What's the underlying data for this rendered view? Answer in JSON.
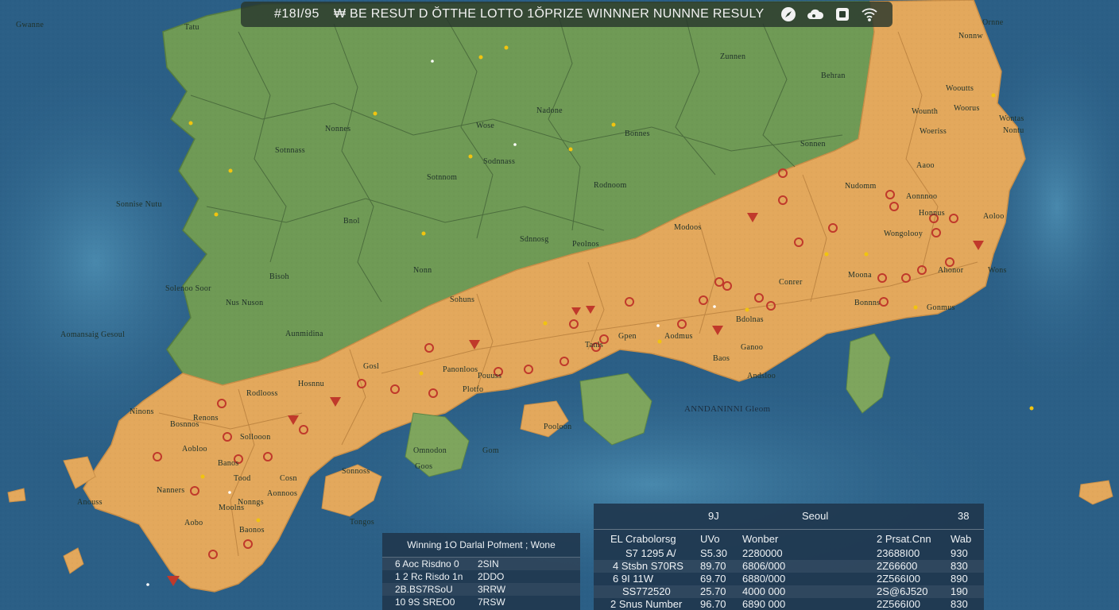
{
  "header": {
    "draw_number": "#18I/95",
    "title": "₩ BE RESUT D ŎTTHE LOTTO 1ŎPRIZE WINNNER NUNNNE RESULY",
    "icons": [
      "compass-icon",
      "cloud-icon",
      "camera-icon",
      "wifi-icon"
    ]
  },
  "colors": {
    "sea": "#2b5f86",
    "sea_shallow": "#3e7ea3",
    "land_green": "#6f9a55",
    "land_orange": "#e3a85c",
    "marker_red": "#c0392b",
    "marker_yellow": "#f1c40f",
    "panel_bg": "#203750"
  },
  "map": {
    "labels": [
      "Gwanne",
      "Tatu",
      "Ornne",
      "Zunnen",
      "Behran",
      "Nonnw",
      "Nadone",
      "Wooutts",
      "Wounth",
      "Woorus",
      "Wontas",
      "Woeriss",
      "Nonnes",
      "Wose",
      "Bonnes",
      "Nontu",
      "Sonnise Nutu",
      "Sotnnass",
      "Bnol",
      "Sodnnass",
      "Sonnen",
      "Sotnnom",
      "Rodnoom",
      "Solenoo Soor",
      "Nus Nuson",
      "Aomansaig Gesoul",
      "Aunmidina",
      "Sdnnosg",
      "Bisoh",
      "Nonn",
      "Sohuns",
      "Aaoo",
      "Nudomm",
      "Aonnnoo",
      "Honnus",
      "Aoloo",
      "Wongolooy",
      "Ahonor",
      "Moona",
      "Wons",
      "Conrer",
      "Bdolnas",
      "Panonloos",
      "Pouuss",
      "Anmoonnian Cleom",
      "Ganoo",
      "Baos",
      "Andsloo",
      "Bonnns",
      "Gonmus",
      "Aodmus",
      "Gpen",
      "Tanls",
      "Plotfo",
      "Gosl",
      "Hosnnu",
      "Rodlooss",
      "Ninons",
      "Renons",
      "Bosnnos",
      "Sollooon",
      "Aobloo",
      "Banos",
      "Cosn",
      "Tood",
      "Nanners",
      "Aonnoos",
      "Nonngs",
      "Anouss",
      "Moolns",
      "Aobo",
      "Baonos",
      "Sonnoss",
      "Omnodon",
      "Gom",
      "Pooloon",
      "Goos",
      "Tongos",
      "Peolnos",
      "Modoos"
    ],
    "sea_label": "ANNDANINNI Gleom"
  },
  "left_panel": {
    "title": "Winning 1O Darlal Pofment ; Wone",
    "rows": [
      {
        "a": "6 Aoc Risdno 0",
        "b": "2SIN"
      },
      {
        "a": "1 2 Rc Risdo 1n",
        "b": "2DDO"
      },
      {
        "a": "2B.BS7RSoU",
        "b": "3RRW"
      },
      {
        "a": "10 9S SREO0",
        "b": "7RSW"
      }
    ]
  },
  "right_panel": {
    "header": {
      "left": "9J",
      "center": "Seoul",
      "right": "38"
    },
    "columns": [
      "EL Crabolorsg",
      "UVo",
      "Wonber",
      "2 Prsat.Cnn",
      "Wab"
    ],
    "rows": [
      [
        "S7 1295 A/",
        "S5.30",
        "2280000",
        "23688I00",
        "930"
      ],
      [
        "4 Stsbn S70RS",
        "89.70",
        "6806/000",
        "2Z66600",
        "830"
      ],
      [
        "6 9I 11W",
        "69.70",
        "6880/000",
        "2Z566I00",
        "890"
      ],
      [
        "SS772520",
        "25.70",
        "4000 000",
        "2S@6J520",
        "190"
      ],
      [
        "2 Snus Number",
        "96.70",
        "6890 000",
        "2Z566I00",
        "830"
      ]
    ]
  }
}
